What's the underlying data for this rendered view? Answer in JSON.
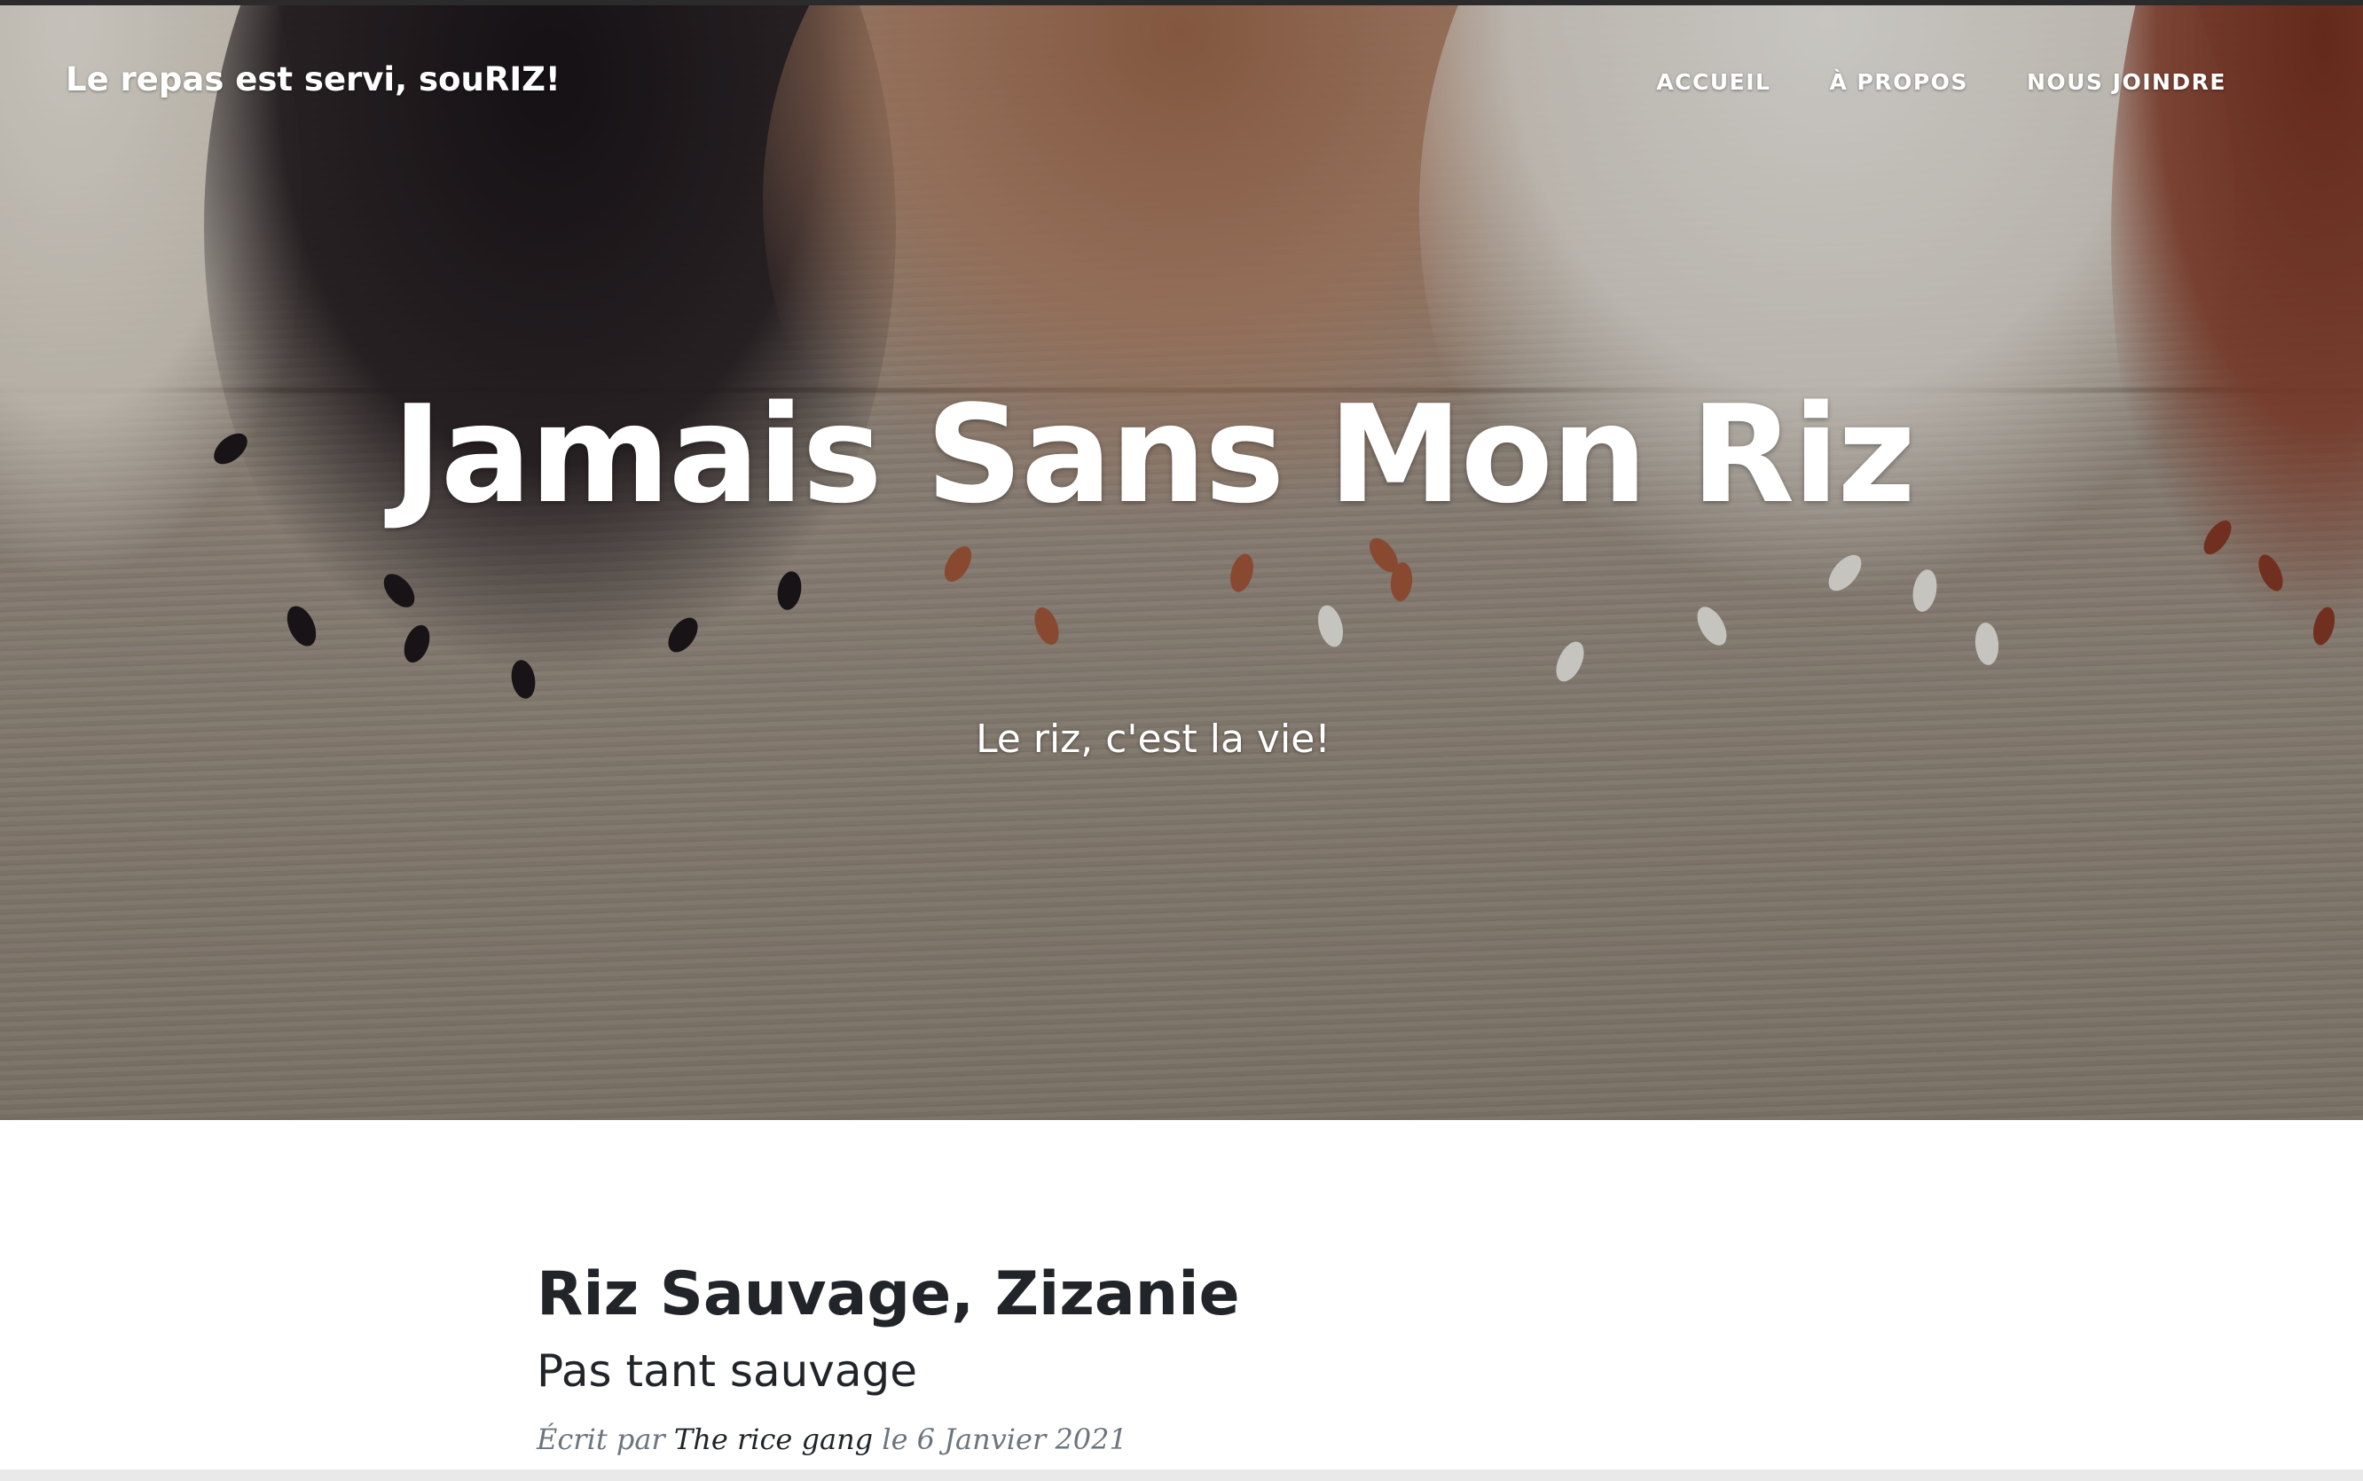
{
  "nav": {
    "brand": "Le repas est servi, souRIZ!",
    "links": [
      "ACCUEIL",
      "À PROPOS",
      "NOUS JOINDRE"
    ]
  },
  "hero": {
    "heading": "Jamais Sans Mon Riz",
    "subheading": "Le riz, c'est la vie!",
    "background": "rice varieties on wooden table"
  },
  "post": {
    "title": "Riz Sauvage, Zizanie",
    "subtitle": "Pas tant sauvage",
    "meta_prefix": "Écrit par",
    "author": "The rice gang",
    "meta_date": "le 6 Janvier 2021"
  },
  "colors": {
    "text_dark": "#212529",
    "meta_gray": "#6c757d",
    "white": "#ffffff"
  }
}
